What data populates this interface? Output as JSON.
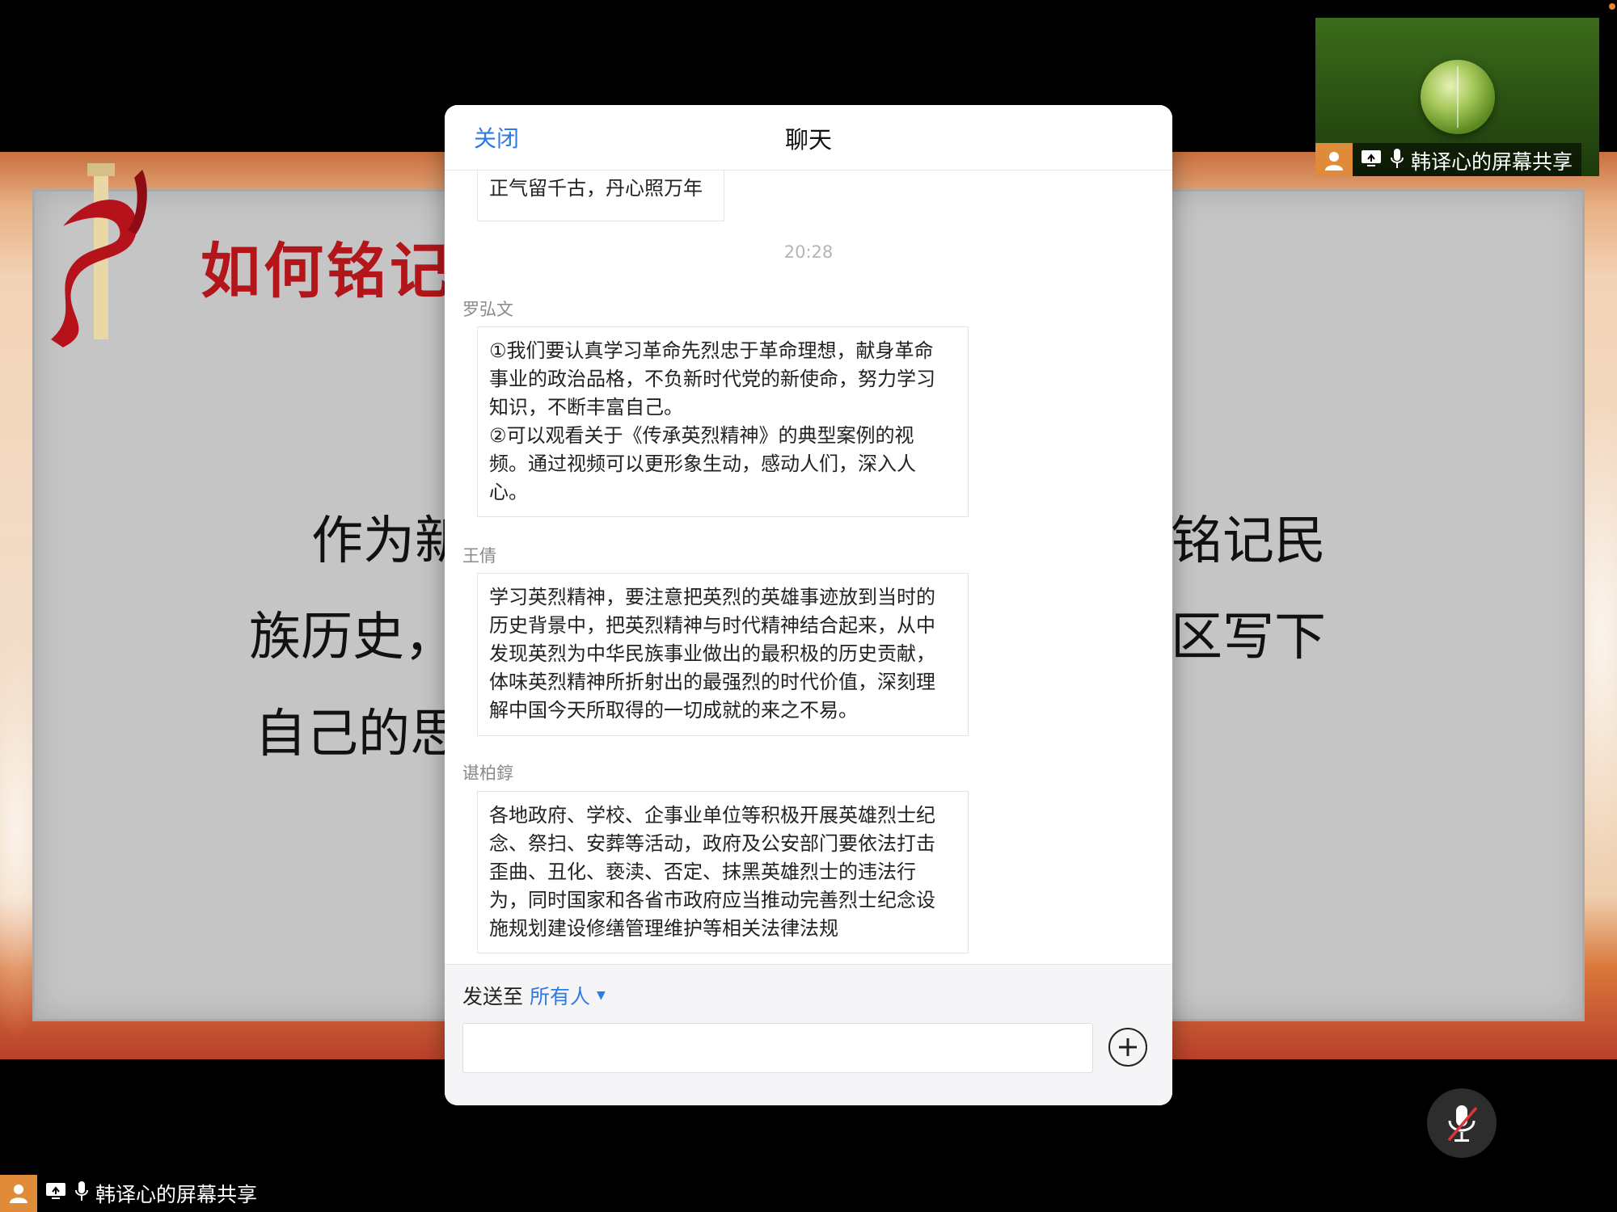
{
  "slide": {
    "title": "如何铭记",
    "lines": [
      "作为新",
      "族历史，",
      "自己的思",
      "铭记民",
      "区写下"
    ]
  },
  "participant_tile": {
    "label": "韩译心的屏幕共享"
  },
  "bottom_bar": {
    "label": "韩译心的屏幕共享"
  },
  "chat": {
    "close_label": "关闭",
    "title": "聊天",
    "messages": [
      {
        "sender": "",
        "text": "正气留千古，丹心照万年"
      },
      {
        "timestamp": "20:28"
      },
      {
        "sender": "罗弘文",
        "text": "①我们要认真学习革命先烈忠于革命理想，献身革命\n事业的政治品格，不负新时代党的新使命，努力学习\n知识，不断丰富自己。\n②可以观看关于《传承英烈精神》的典型案例的视\n频。通过视频可以更形象生动，感动人们，深入人\n心。"
      },
      {
        "sender": "王倩",
        "text": "学习英烈精神，要注意把英烈的英雄事迹放到当时的\n历史背景中，把英烈精神与时代精神结合起来，从中\n发现英烈为中华民族事业做出的最积极的历史贡献，\n体味英烈精神所折射出的最强烈的时代价值，深刻理\n解中国今天所取得的一切成就的来之不易。"
      },
      {
        "sender": "谌柏錞",
        "text": "各地政府、学校、企事业单位等积极开展英雄烈士纪\n念、祭扫、安葬等活动，政府及公安部门要依法打击\n歪曲、丑化、亵渎、否定、抹黑英雄烈士的违法行\n为，同时国家和各省市政府应当推动完善烈士纪念设\n施规划建设修缮管理维护等相关法律法规"
      }
    ],
    "send_to_label": "发送至",
    "recipient": "所有人",
    "input_value": "",
    "input_placeholder": ""
  }
}
